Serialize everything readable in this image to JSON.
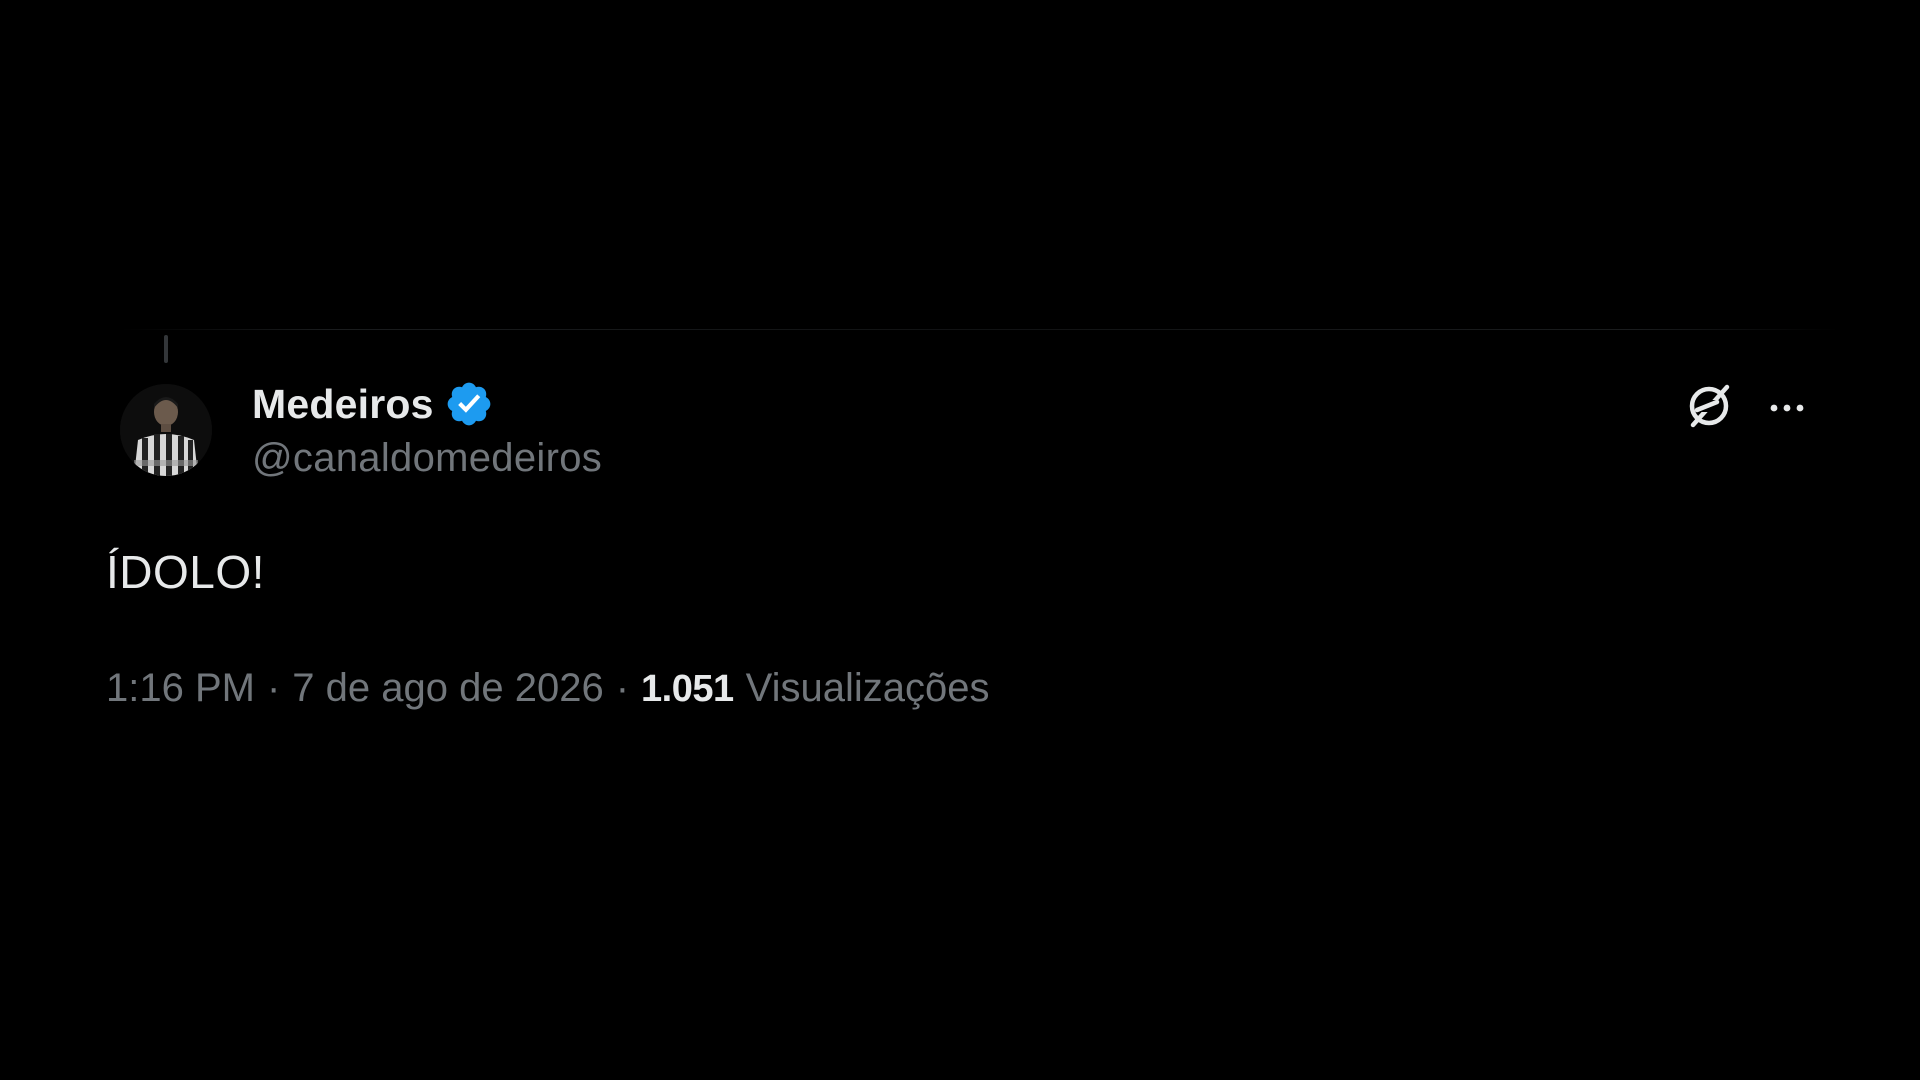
{
  "tweet": {
    "author": {
      "display_name": "Medeiros",
      "handle": "@canaldomedeiros",
      "verified": true,
      "verified_badge_color": "#1d9bf0",
      "avatar_icon": "profile-photo"
    },
    "text": "ÍDOLO!",
    "time": "1:16 PM",
    "date": "7 de ago de 2026",
    "separator": "·",
    "views_count": "1.051",
    "views_label": "Visualizações"
  },
  "actions": {
    "grok_icon": "grok-icon",
    "more_icon": "more-icon"
  },
  "theme": {
    "background": "#000000",
    "primary_text": "#e7e9ea",
    "secondary_text": "#71767b",
    "accent": "#1d9bf0"
  }
}
